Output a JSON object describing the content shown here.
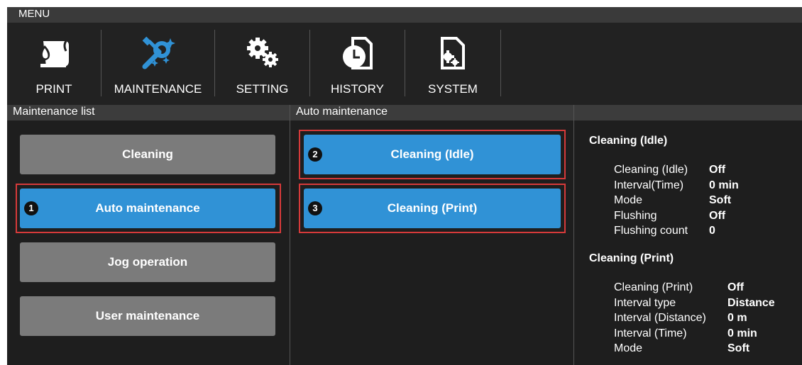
{
  "menu": {
    "title": "MENU"
  },
  "toolbar": {
    "print_label": "PRINT",
    "maintenance_label": "MAINTENANCE",
    "setting_label": "SETTING",
    "history_label": "HISTORY",
    "system_label": "SYSTEM",
    "icons": [
      "print-icon",
      "maintenance-icon",
      "setting-icon",
      "history-icon",
      "system-icon"
    ]
  },
  "maintenance_list": {
    "header": "Maintenance list",
    "items": [
      {
        "label": "Cleaning",
        "selected": false
      },
      {
        "label": "Auto maintenance",
        "selected": true,
        "marker": "1"
      },
      {
        "label": "Jog operation",
        "selected": false
      },
      {
        "label": "User maintenance",
        "selected": false
      }
    ]
  },
  "auto_maintenance": {
    "header": "Auto maintenance",
    "items": [
      {
        "label": "Cleaning (Idle)",
        "marker": "2"
      },
      {
        "label": "Cleaning (Print)",
        "marker": "3"
      }
    ]
  },
  "info": {
    "idle": {
      "title": "Cleaning (Idle)",
      "rows": [
        {
          "key": "Cleaning (Idle)",
          "value": "Off"
        },
        {
          "key": "Interval(Time)",
          "value": "0 min"
        },
        {
          "key": "Mode",
          "value": "Soft"
        },
        {
          "key": "Flushing",
          "value": "Off"
        },
        {
          "key": "Flushing count",
          "value": "0"
        }
      ]
    },
    "print": {
      "title": "Cleaning (Print)",
      "rows": [
        {
          "key": "Cleaning (Print)",
          "value": "Off"
        },
        {
          "key": "Interval type",
          "value": "Distance"
        },
        {
          "key": "Interval (Distance)",
          "value": "0 m"
        },
        {
          "key": "Interval (Time)",
          "value": "0 min"
        },
        {
          "key": "Mode",
          "value": "Soft"
        }
      ]
    }
  },
  "colors": {
    "selected_blue": "#3092d6",
    "button_gray": "#7b7b7b",
    "highlight_red": "#d63a3a",
    "background": "#222222"
  }
}
